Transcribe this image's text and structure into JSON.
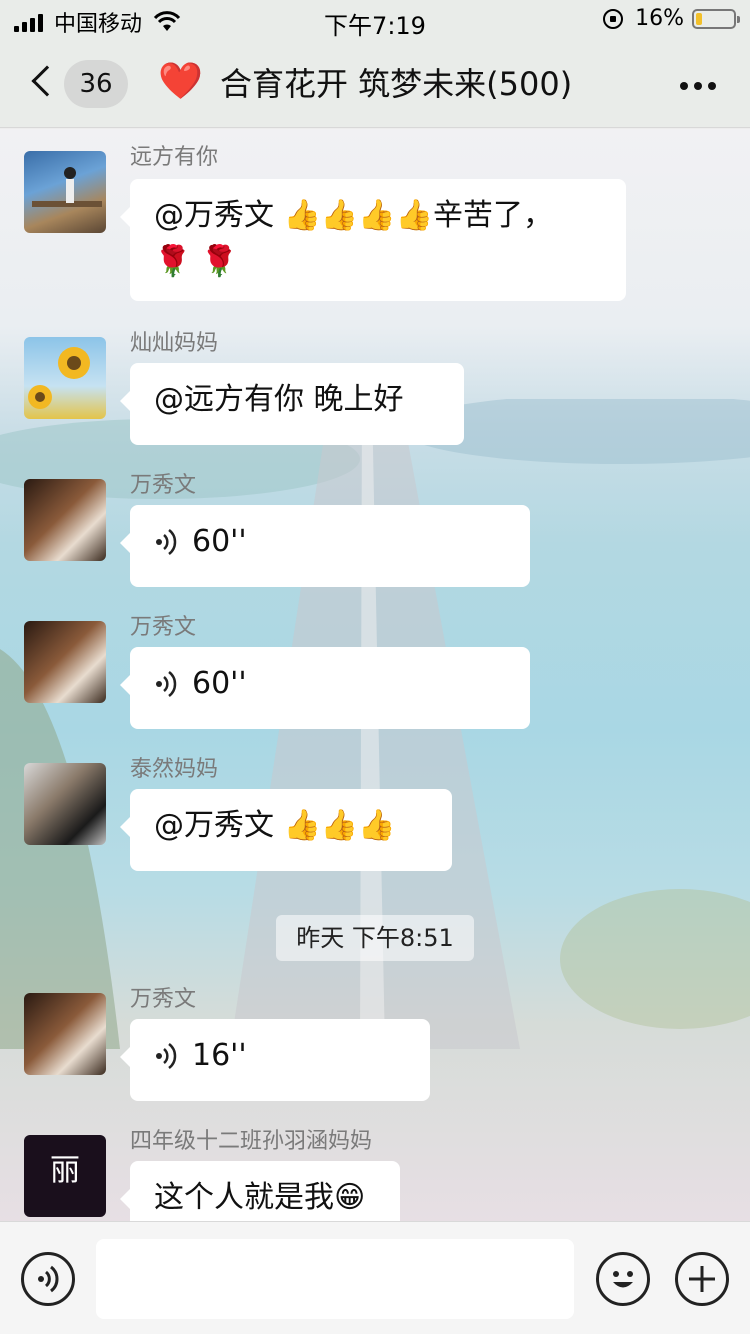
{
  "status_bar": {
    "carrier": "中国移动",
    "time": "下午7:19",
    "battery_percent": "16%",
    "battery_level": 0.16,
    "battery_color": "#f2c02a"
  },
  "nav": {
    "unread_count": "36",
    "title_emoji": "❤️",
    "title": "合育花开 筑梦未来(500)"
  },
  "messages": [
    {
      "sender": "远方有你",
      "text": "@万秀文 👍👍👍👍辛苦了，",
      "text2": "🌹 🌹",
      "type": "text"
    },
    {
      "sender": "灿灿妈妈",
      "text": "@远方有你 晚上好",
      "type": "text"
    },
    {
      "sender": "万秀文",
      "duration": "60''",
      "type": "voice"
    },
    {
      "sender": "万秀文",
      "duration": "60''",
      "type": "voice"
    },
    {
      "sender": "泰然妈妈",
      "text": "@万秀文 👍👍👍",
      "type": "text"
    },
    {
      "sender": "万秀文",
      "duration": "16''",
      "type": "voice"
    },
    {
      "sender": "四年级十二班孙羽涵妈妈",
      "text": "这个人就是我😁",
      "type": "text",
      "avatar_text": "丽"
    }
  ],
  "timestamp": "昨天 下午8:51",
  "input_bar": {
    "voice_icon": "voice-icon",
    "emoji_icon": "emoji-icon",
    "add_icon": "add-icon"
  }
}
